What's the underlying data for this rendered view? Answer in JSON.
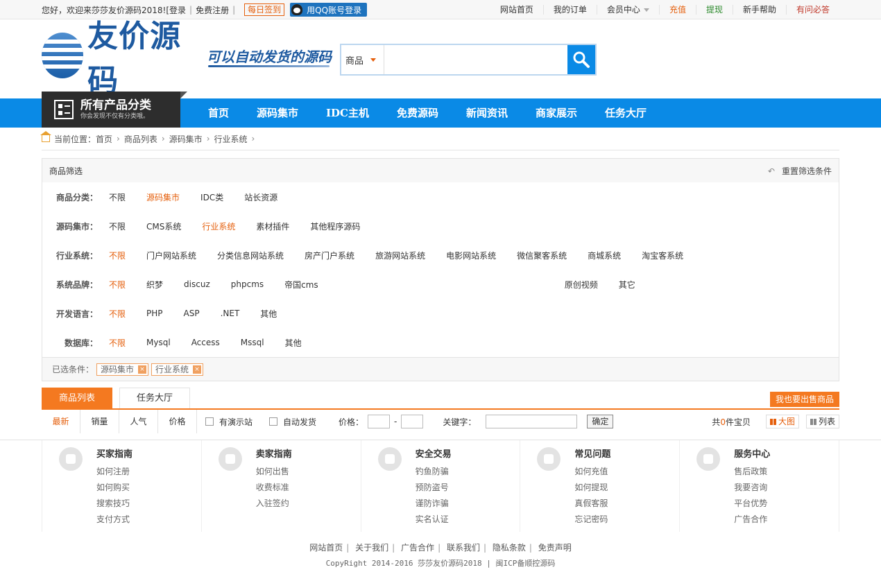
{
  "topbar": {
    "welcome": "您好，欢迎来莎莎友价源码2018!",
    "login": "[登录",
    "register": "免费注册",
    "signin": "每日签到",
    "qq_login": "用QQ账号登录",
    "links": [
      "网站首页",
      "我的订单",
      "会员中心",
      "充值",
      "提现",
      "新手帮助",
      "有问必答"
    ],
    "colors": {
      "recharge": "#e55f0c",
      "withdraw": "#2c8a2c",
      "ask": "#c0392b"
    }
  },
  "header": {
    "logo_text": "友价源码",
    "slogan": "可以自动发货的源码",
    "search_category": "商品",
    "search_placeholder": ""
  },
  "nav": {
    "all_title": "所有产品分类",
    "all_sub": "你会发现不仅有分类哦。",
    "items": [
      "首页",
      "源码集市",
      "IDC主机",
      "免费源码",
      "新闻资讯",
      "商家展示",
      "任务大厅"
    ]
  },
  "breadcrumb": {
    "label": "当前位置：",
    "items": [
      "首页",
      "商品列表",
      "源码集市",
      "行业系统"
    ]
  },
  "filter": {
    "title": "商品筛选",
    "reset": "重置筛选条件",
    "rows": [
      {
        "label": "商品分类：",
        "options": [
          "不限",
          "源码集市",
          "IDC类",
          "站长资源"
        ]
      },
      {
        "label": "源码集市：",
        "options": [
          "不限",
          "CMS系统",
          "行业系统",
          "素材插件",
          "其他程序源码"
        ]
      },
      {
        "label": "行业系统：",
        "options": [
          "不限",
          "门户网站系统",
          "分类信息网站系统",
          "房产门户系统",
          "旅游网站系统",
          "电影网站系统",
          "微信聚客系统",
          "商城系统",
          "淘宝客系统"
        ]
      },
      {
        "label": "系统品牌：",
        "options": [
          "不限",
          "织梦",
          "discuz",
          "phpcms",
          "帝国cms",
          "原创视频",
          "其它"
        ]
      },
      {
        "label": "开发语言：",
        "options": [
          "不限",
          "PHP",
          "ASP",
          ".NET",
          "其他"
        ]
      },
      {
        "label": "数据库：",
        "options": [
          "不限",
          "Mysql",
          "Access",
          "Mssql",
          "其他"
        ]
      }
    ],
    "selected_label": "已选条件：",
    "selected": [
      "源码集市",
      "行业系统"
    ],
    "close_glyph": "×"
  },
  "tabs": {
    "items": [
      "商品列表",
      "任务大厅"
    ],
    "sell": "我也要出售商品"
  },
  "sortbar": {
    "sorts": [
      "最新",
      "销量",
      "人气",
      "价格"
    ],
    "demo": "有演示站",
    "auto": "自动发货",
    "price_label": "价格：",
    "dash": "-",
    "keyword_label": "关键字：",
    "confirm": "确定",
    "total_pre": "共",
    "total_num": "0",
    "total_post": "件宝贝",
    "view_big": "大图",
    "view_list": "列表"
  },
  "help": [
    {
      "title": "买家指南",
      "icon": "compass-icon",
      "items": [
        "如何注册",
        "如何购买",
        "搜索技巧",
        "支付方式"
      ]
    },
    {
      "title": "卖家指南",
      "icon": "truck-icon",
      "items": [
        "如何出售",
        "收费标准",
        "入驻签约"
      ]
    },
    {
      "title": "安全交易",
      "icon": "wallet-icon",
      "items": [
        "钓鱼防骗",
        "预防盗号",
        "谨防诈骗",
        "实名认证"
      ]
    },
    {
      "title": "常见问题",
      "icon": "wrench-icon",
      "items": [
        "如何充值",
        "如何提现",
        "真假客服",
        "忘记密码"
      ]
    },
    {
      "title": "服务中心",
      "icon": "heart-icon",
      "items": [
        "售后政策",
        "我要咨询",
        "平台优势",
        "广告合作"
      ]
    }
  ],
  "footer": {
    "links": [
      "网站首页",
      "关于我们",
      "广告合作",
      "联系我们",
      "隐私条款",
      "免责声明"
    ],
    "copyright": "CopyRight 2014-2016 莎莎友价源码2018 | 闽ICP备顺控源码"
  }
}
